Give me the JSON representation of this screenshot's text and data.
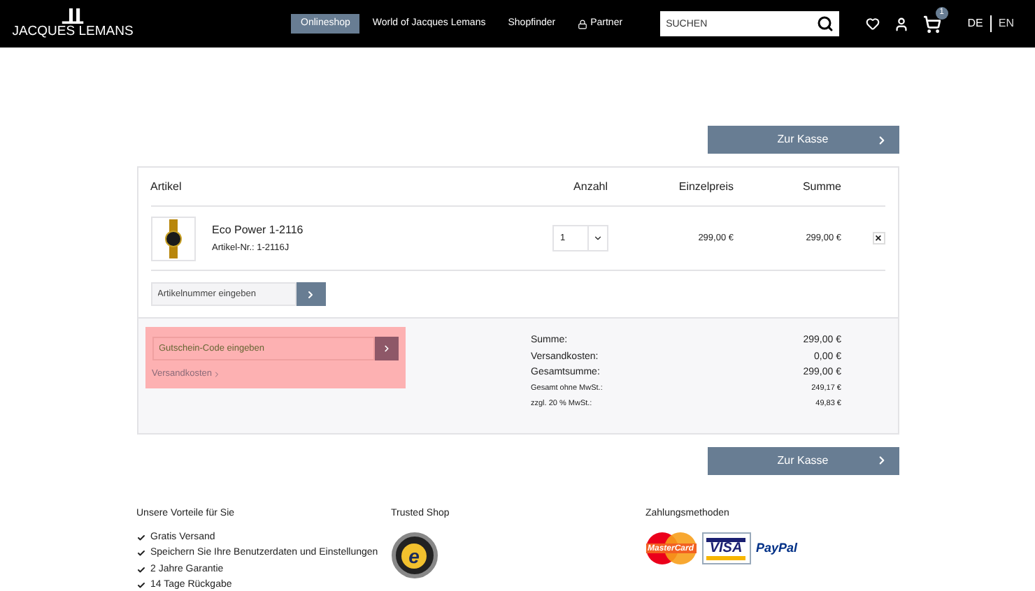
{
  "header": {
    "logo": "JACQUES LEMANS",
    "nav": [
      {
        "label": "Onlineshop",
        "selected": true,
        "kind": "plain"
      },
      {
        "label": "World of Jacques Lemans",
        "selected": false,
        "kind": "plain"
      },
      {
        "label": "Shopfinder",
        "selected": false,
        "kind": "plain"
      },
      {
        "label": "Partner",
        "selected": false,
        "kind": "lock"
      }
    ],
    "search": {
      "placeholder": "SUCHEN"
    },
    "cart_count": "1",
    "languages": [
      {
        "label": "DE",
        "selected": true
      },
      {
        "label": "EN",
        "selected": false
      }
    ]
  },
  "checkout_button": "Zur Kasse",
  "cart": {
    "columns": [
      "Artikel",
      "Anzahl",
      "Einzelpreis",
      "Summe"
    ],
    "items": [
      {
        "name": "Eco Power 1-2116",
        "sku": "Artikel-Nr.: 1-2116J",
        "quantity": "1",
        "unit_price": "299,00 €",
        "total": "299,00 €",
        "remove": "×"
      }
    ],
    "article_input": {
      "placeholder": "Artikelnummer eingeben"
    }
  },
  "voucher": {
    "placeholder": "Gutschein-Code eingeben",
    "shipping_link": "Versandkosten",
    "highlighted": true
  },
  "totals": [
    {
      "label": "Summe:",
      "value": "299,00 €",
      "kind": "normal"
    },
    {
      "label": "Versandkosten:",
      "value": "0,00 €",
      "kind": "normal"
    },
    {
      "label": "Gesamtsumme:",
      "value": "299,00 €",
      "kind": "normal"
    },
    {
      "label": "Gesamt ohne MwSt.:",
      "value": "249,17 €",
      "kind": "small"
    },
    {
      "label": "zzgl. 20 % MwSt.:",
      "value": "49,83 €",
      "kind": "small"
    }
  ],
  "checkout_button_bottom": "Zur Kasse",
  "footer": {
    "benefits": {
      "title": "Unsere Vorteile für Sie",
      "items": [
        "Gratis Versand",
        "Speichern Sie Ihre Benutzerdaten und Einstellungen",
        "2 Jahre Garantie",
        "14 Tage Rückgabe"
      ]
    },
    "trusted": {
      "title": "Trusted Shop",
      "badge_letter": "e"
    },
    "payment": {
      "title": "Zahlungsmethoden",
      "logos": [
        "MasterCard",
        "VISA",
        "PayPal"
      ]
    }
  }
}
